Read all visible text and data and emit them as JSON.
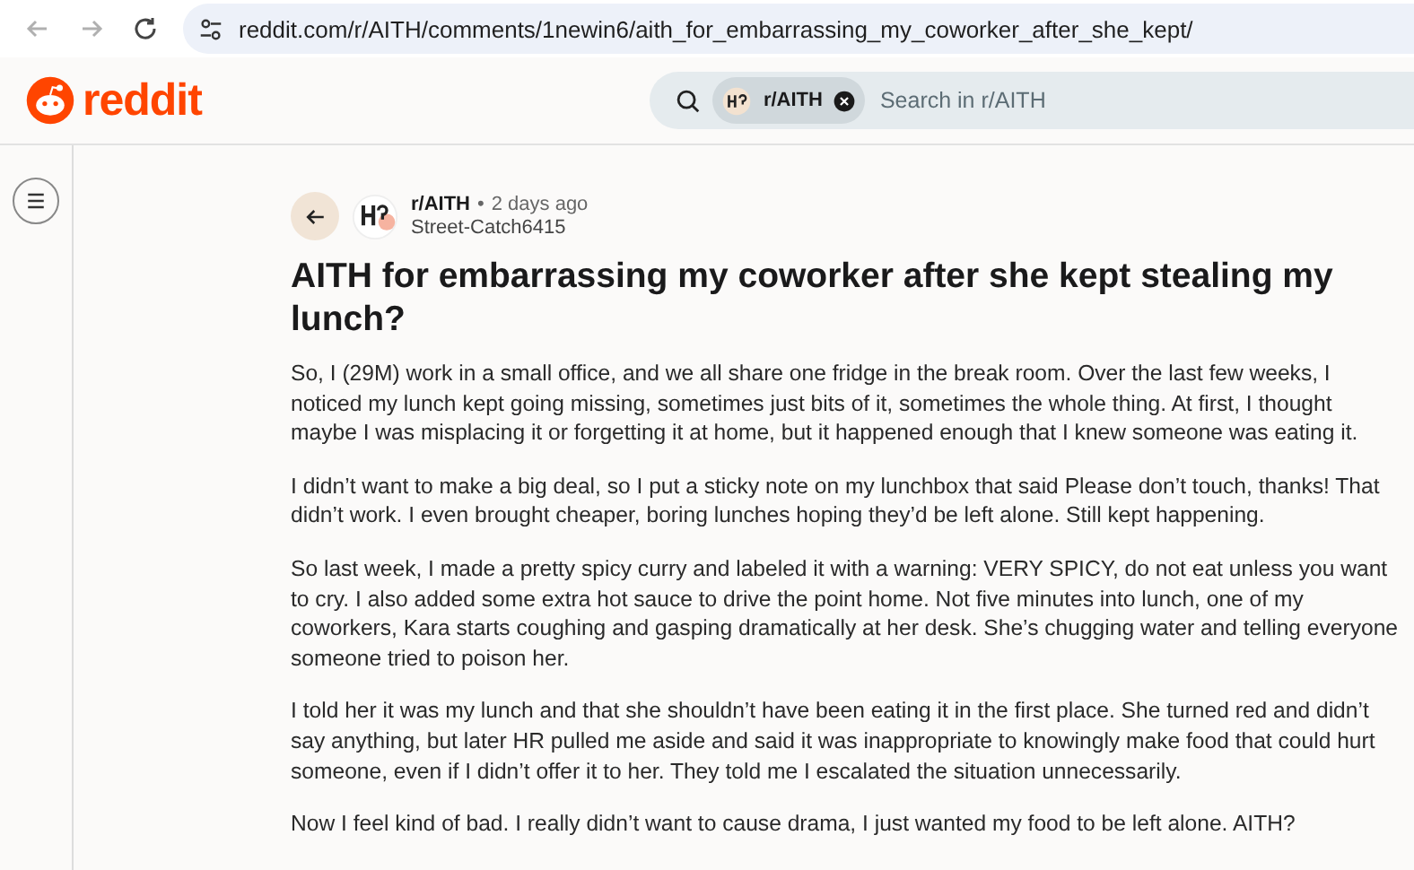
{
  "browser": {
    "url": "reddit.com/r/AITH/comments/1newin6/aith_for_embarrassing_my_coworker_after_she_kept/"
  },
  "header": {
    "logo": "reddit",
    "search": {
      "community": "r/AITH",
      "placeholder": "Search in r/AITH"
    }
  },
  "post": {
    "subreddit": "r/AITH",
    "separator": "•",
    "time": "2 days ago",
    "author": "Street-Catch6415",
    "title": "AITH for embarrassing my coworker after she kept stealing my lunch?",
    "paragraphs": [
      "So, I (29M) work in a small office, and we all share one fridge in the break room. Over the last few weeks, I noticed my lunch kept going missing, sometimes just bits of it, sometimes the whole thing. At first, I thought maybe I was misplacing it or forgetting it at home, but it happened enough that I knew someone was eating it.",
      "I didn’t want to make a big deal, so I put a sticky note on my lunchbox that said Please don’t touch, thanks! That didn’t work. I even brought cheaper, boring lunches hoping they’d be left alone. Still kept happening.",
      "So last week, I made a pretty spicy curry and labeled it with a warning: VERY SPICY, do not eat unless you want to cry. I also added some extra hot sauce to drive the point home. Not five minutes into lunch, one of my coworkers, Kara starts coughing and gasping dramatically at her desk. She’s chugging water and telling everyone someone tried to poison her.",
      "I told her it was my lunch and that she shouldn’t have been eating it in the first place. She turned red and didn’t say anything, but later HR pulled me aside and said it was inappropriate to knowingly make food that could hurt someone, even if I didn’t offer it to her. They told me I escalated the situation unnecessarily.",
      "Now I feel kind of bad. I really didn’t want to cause drama, I just wanted my food to be left alone. AITH?"
    ]
  }
}
